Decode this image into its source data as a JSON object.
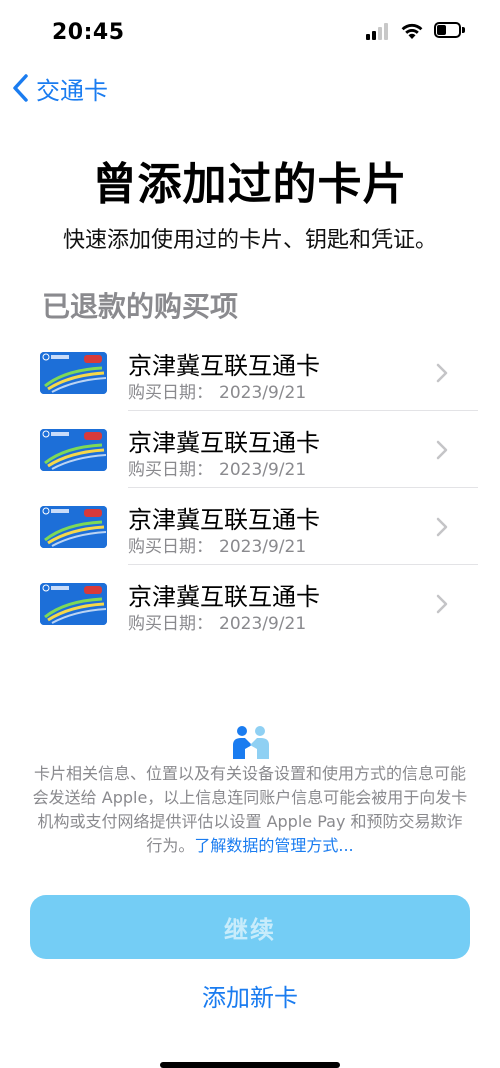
{
  "status_bar": {
    "time": "20:45"
  },
  "nav": {
    "back_label": "交通卡"
  },
  "page": {
    "title": "曾添加过的卡片",
    "subtitle": "快速添加使用过的卡片、钥匙和凭证。",
    "section_header": "已退款的购买项"
  },
  "cards": [
    {
      "name": "京津冀互联互通卡",
      "date_label": "购买日期：",
      "date": "2023/9/21"
    },
    {
      "name": "京津冀互联互通卡",
      "date_label": "购买日期：",
      "date": "2023/9/21"
    },
    {
      "name": "京津冀互联互通卡",
      "date_label": "购买日期：",
      "date": "2023/9/21"
    },
    {
      "name": "京津冀互联互通卡",
      "date_label": "购买日期：",
      "date": "2023/9/21"
    }
  ],
  "privacy": {
    "text": "卡片相关信息、位置以及有关设备设置和使用方式的信息可能会发送给 Apple，以上信息连同账户信息可能会被用于向发卡机构或支付网络提供评估以设置 Apple Pay 和预防交易欺诈行为。",
    "link": "了解数据的管理方式..."
  },
  "buttons": {
    "continue": "继续",
    "add_new": "添加新卡"
  },
  "colors": {
    "accent": "#1a7cf0",
    "button_disabled": "#74cdf5",
    "secondary_text": "#8a8a8e"
  }
}
